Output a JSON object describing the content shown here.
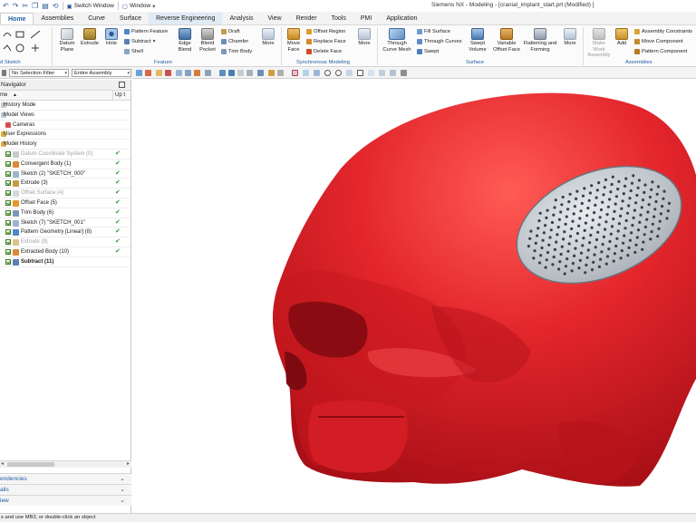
{
  "window": {
    "title": "Siemens NX - Modeling - [cranial_implant_start.prt (Modified) ]"
  },
  "quick_access": {
    "switch_window": "Switch Window",
    "window_menu": "Window"
  },
  "menu_tabs": [
    {
      "label": "Home",
      "active": true
    },
    {
      "label": "Assemblies"
    },
    {
      "label": "Curve"
    },
    {
      "label": "Surface"
    },
    {
      "label": "Reverse Engineering",
      "hovered": true
    },
    {
      "label": "Analysis"
    },
    {
      "label": "View"
    },
    {
      "label": "Render"
    },
    {
      "label": "Tools"
    },
    {
      "label": "PMI"
    },
    {
      "label": "Application"
    }
  ],
  "ribbon": {
    "sketch_group": "d Sketch",
    "feature": {
      "group_label": "Feature",
      "datum_plane": "Datum Plane",
      "extrude": "Extrude",
      "hole": "Hole",
      "pattern_feature": "Pattern Feature",
      "subtract": "Subtract",
      "shell": "Shell",
      "edge_blend": "Edge Blend",
      "blend_pocket": "Blend Pocket",
      "draft": "Draft",
      "chamfer": "Chamfer",
      "trim_body": "Trim Body",
      "more": "More"
    },
    "sync": {
      "group_label": "Synchronous Modeling",
      "move_face": "Move Face",
      "offset_region": "Offset Region",
      "replace_face": "Replace Face",
      "delete_face": "Delete Face",
      "more": "More"
    },
    "surface": {
      "group_label": "Surface",
      "through_curve_mesh": "Through Curve Mesh",
      "fill_surface": "Fill Surface",
      "through_curves": "Through Curves",
      "swept": "Swept",
      "swept_volume": "Swept Volume",
      "variable_offset_face": "Variable Offset Face",
      "flattening_forming": "Flattening and Forming",
      "more": "More"
    },
    "assemblies": {
      "group_label": "Assemblies",
      "make_work_assembly": "Make Work Assembly",
      "add": "Add",
      "assembly_constraints": "Assembly Constraints",
      "move_component": "Move Component",
      "pattern_component": "Pattern Component"
    }
  },
  "selection_bar": {
    "filter": "No Selection Filter",
    "scope": "Entire Assembly"
  },
  "navigator": {
    "title": "Navigator",
    "col_name": "me",
    "col_uptodate": "Up t",
    "groups": [
      {
        "label": "History Mode"
      },
      {
        "label": "Model Views"
      },
      {
        "label": "Cameras"
      },
      {
        "label": "User Expressions"
      },
      {
        "label": "Model History"
      }
    ],
    "features": [
      {
        "label": "Datum Coordinate System (0)",
        "dim": true,
        "ok": true
      },
      {
        "label": "Convergent Body (1)",
        "ok": true
      },
      {
        "label": "Sketch (2) \"SKETCH_000\"",
        "ok": true
      },
      {
        "label": "Extrude (3)",
        "ok": true
      },
      {
        "label": "Offset Surface (4)",
        "dim": true,
        "ok": true
      },
      {
        "label": "Offset Face (5)",
        "ok": true
      },
      {
        "label": "Trim Body (6)",
        "ok": true
      },
      {
        "label": "Sketch (7) \"SKETCH_001\"",
        "ok": true
      },
      {
        "label": "Pattern Geometry [Linear] (8)",
        "ok": true
      },
      {
        "label": "Extrude (9)",
        "dim": true,
        "ok": true
      },
      {
        "label": "Extracted Body (10)",
        "ok": true
      },
      {
        "label": "Subtract (11)",
        "bold": true,
        "ok": false
      }
    ],
    "sections": [
      "endencies",
      "ails",
      "iew"
    ]
  },
  "status_bar": {
    "message": "s and use MB3, or double-click an object"
  },
  "colors": {
    "accent": "#1f5fa5",
    "skull_red": "#e3262c",
    "implant_gray": "#c9cdd1",
    "check_green": "#2e9a2e"
  }
}
